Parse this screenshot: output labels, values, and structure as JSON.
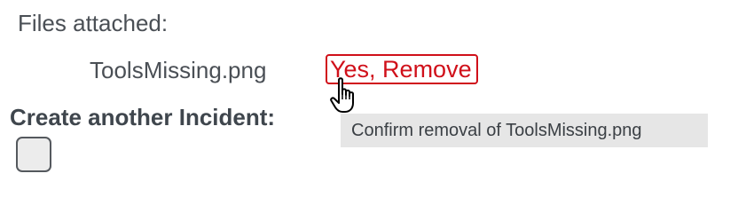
{
  "attachments": {
    "heading": "Files attached:",
    "file_name": "ToolsMissing.png",
    "remove_label": "Yes, Remove",
    "remove_color": "#d0101a"
  },
  "incident": {
    "label": "Create another Incident:",
    "checked": false
  },
  "tooltip": {
    "text": "Confirm removal of ToolsMissing.png"
  },
  "cursor": {
    "icon": "hand-pointer-icon"
  }
}
